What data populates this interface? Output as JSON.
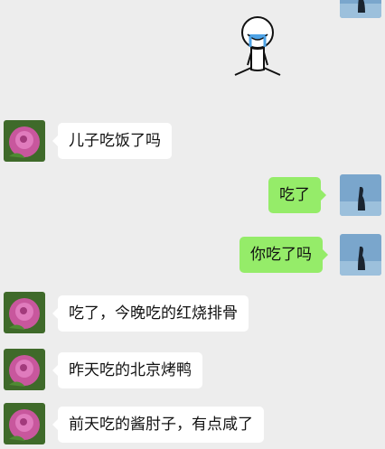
{
  "chat": {
    "sticker": {
      "name": "crying-stick-figure-sticker"
    },
    "messages": [
      {
        "side": "left",
        "text": "儿子吃饭了吗"
      },
      {
        "side": "right",
        "text": "吃了"
      },
      {
        "side": "right",
        "text": "你吃了吗"
      },
      {
        "side": "left",
        "text": "吃了，今晚吃的红烧排骨"
      },
      {
        "side": "left",
        "text": "昨天吃的北京烤鸭"
      },
      {
        "side": "left",
        "text": "前天吃的酱肘子，有点咸了"
      }
    ]
  },
  "colors": {
    "background": "#ededed",
    "bubble_self": "#95ec69",
    "bubble_other": "#ffffff"
  }
}
